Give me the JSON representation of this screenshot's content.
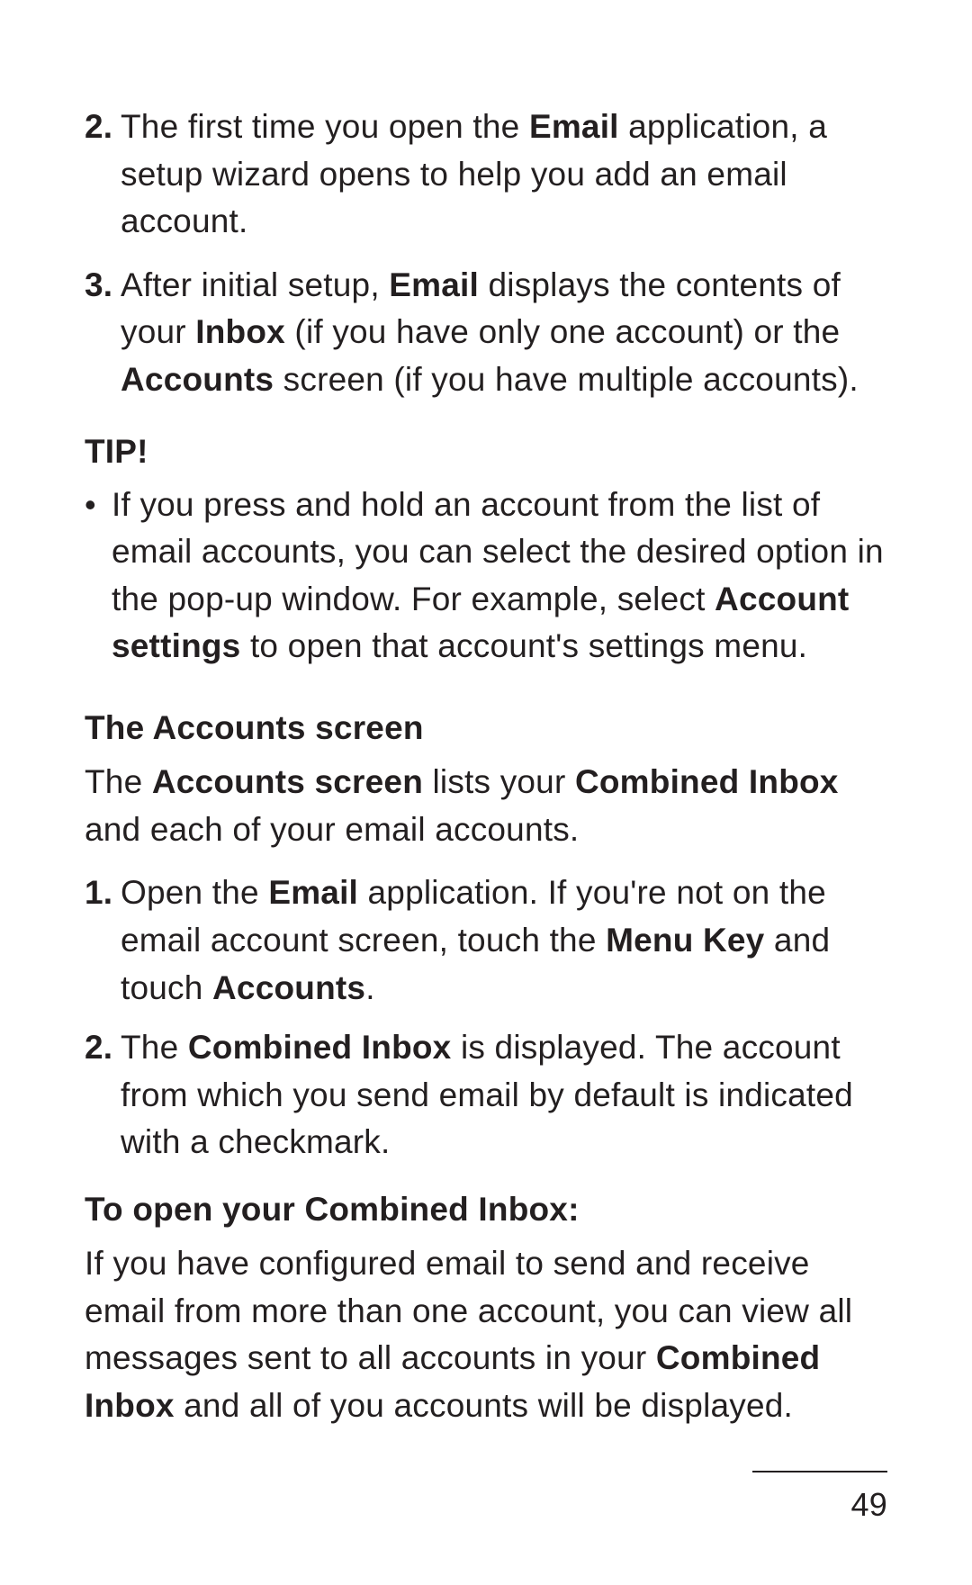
{
  "step2": {
    "marker": "2.",
    "t1": "The first time you open the ",
    "b1": "Email",
    "t2": " application, a setup wizard opens to help you add an email account."
  },
  "step3": {
    "marker": "3.",
    "t1": "After initial setup, ",
    "b1": "Email",
    "t2": " displays the contents of your ",
    "b2": "Inbox",
    "t3": " (if you have only one account) or the ",
    "b3": "Accounts",
    "t4": " screen (if you have multiple accounts)."
  },
  "tip": {
    "heading": "TIP!",
    "t1": "If you press and hold an account from the list of email accounts, you can select the desired option in the pop-up window. For example, select ",
    "b1": "Account settings",
    "t2": " to open that account's settings menu."
  },
  "accounts": {
    "heading": "The Accounts screen",
    "intro_t1": "The ",
    "intro_b1": "Accounts screen",
    "intro_t2": " lists your ",
    "intro_b2": "Combined Inbox",
    "intro_t3": " and each of your email accounts."
  },
  "acctStep1": {
    "marker": "1.",
    "t1": "Open the ",
    "b1": "Email",
    "t2": " application. If you're not on the email account screen, touch the ",
    "b2": "Menu Key",
    "t3": " and touch ",
    "b3": "Accounts",
    "t4": "."
  },
  "acctStep2": {
    "marker": "2.",
    "t1": "The ",
    "b1": "Combined Inbox",
    "t2": " is displayed. The account from which you send email by default is indicated with a checkmark."
  },
  "combined": {
    "heading": "To open your Combined Inbox:",
    "t1": "If you have configured email to send and receive email from more than one account, you can view all messages sent to all accounts in your ",
    "b1": "Combined Inbox",
    "t2": " and all of you accounts will be displayed."
  },
  "pageNumber": "49"
}
